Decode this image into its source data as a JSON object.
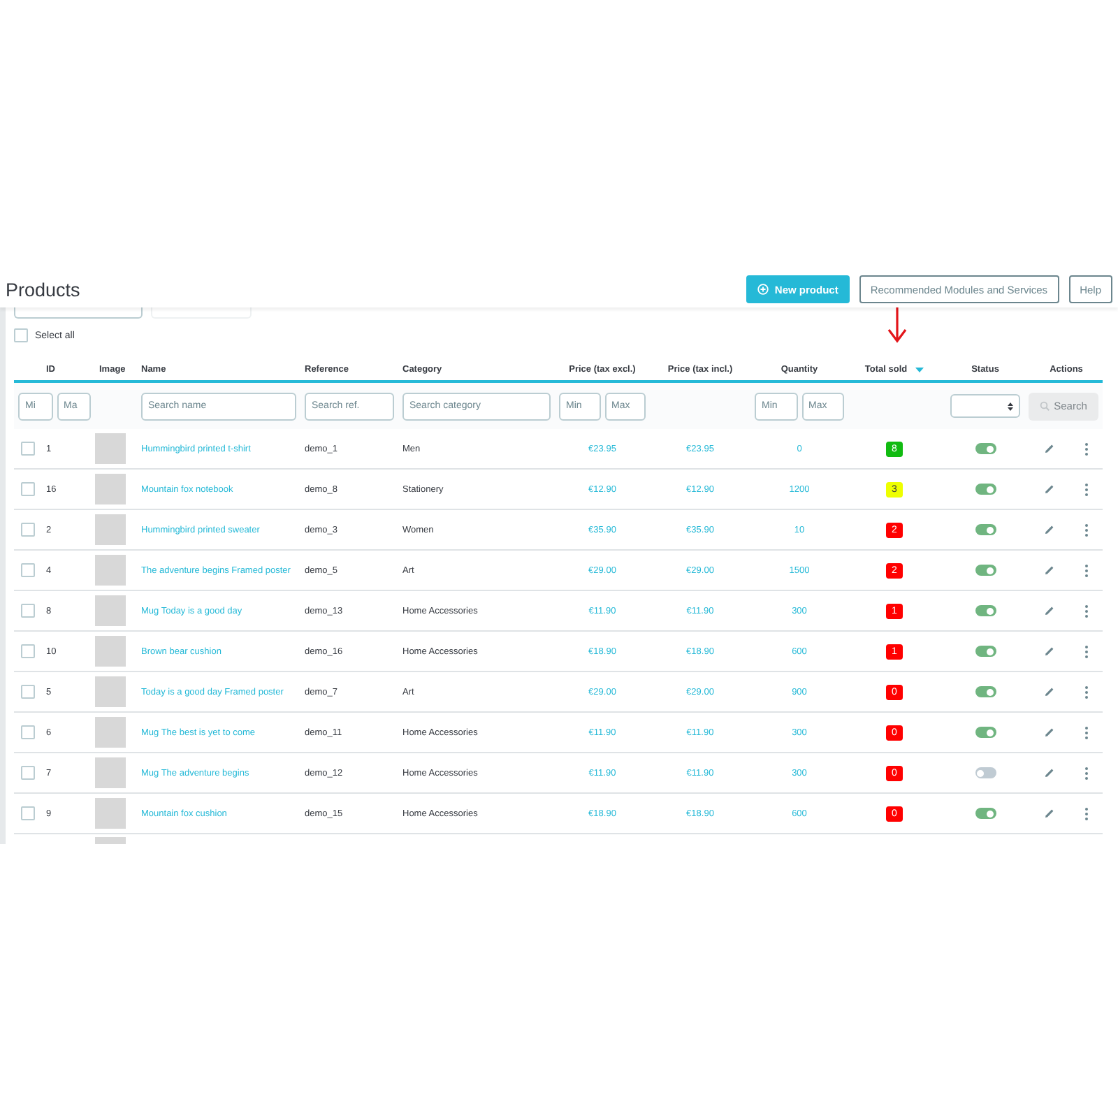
{
  "page": {
    "title": "Products"
  },
  "toolbar_buttons": [
    {
      "kind": "primary",
      "label": "New product"
    },
    {
      "kind": "outline",
      "label": "Recommended Modules and Services"
    },
    {
      "kind": "outline",
      "label": "Help"
    }
  ],
  "select_all": {
    "label": "Select all",
    "checked": false
  },
  "columns": [
    {
      "label": "ID"
    },
    {
      "label": "Image"
    },
    {
      "label": "Name"
    },
    {
      "label": "Reference"
    },
    {
      "label": "Category"
    },
    {
      "label": "Price (tax excl.)"
    },
    {
      "label": "Price (tax incl.)"
    },
    {
      "label": "Quantity"
    },
    {
      "label": "Total sold",
      "sorted": true
    },
    {
      "label": "Status"
    },
    {
      "label": "Actions"
    }
  ],
  "filters": {
    "id_min": {
      "placeholder": "Mi"
    },
    "id_max": {
      "placeholder": "Ma"
    },
    "name": {
      "placeholder": "Search name"
    },
    "reference": {
      "placeholder": "Search ref."
    },
    "category": {
      "placeholder": "Search category"
    },
    "price_min": {
      "placeholder": "Min"
    },
    "price_max": {
      "placeholder": "Max"
    },
    "qty_min": {
      "placeholder": "Min"
    },
    "qty_max": {
      "placeholder": "Max"
    },
    "search_button": "Search"
  },
  "rows": [
    {
      "checked": false,
      "id": "1",
      "name": "Hummingbird printed t-shirt",
      "reference": "demo_1",
      "category": "Men",
      "price_excl": "€23.95",
      "price_incl": "€23.95",
      "quantity": "0",
      "total_sold": "8",
      "color": "#11bb11",
      "on": true
    },
    {
      "checked": false,
      "id": "16",
      "name": "Mountain fox notebook",
      "reference": "demo_8",
      "category": "Stationery",
      "price_excl": "€12.90",
      "price_incl": "€12.90",
      "quantity": "1200",
      "total_sold": "3",
      "color": "#eeff00",
      "on": true
    },
    {
      "checked": false,
      "id": "2",
      "name": "Hummingbird printed sweater",
      "reference": "demo_3",
      "category": "Women",
      "price_excl": "€35.90",
      "price_incl": "€35.90",
      "quantity": "10",
      "total_sold": "2",
      "color": "#ff0000",
      "on": true
    },
    {
      "checked": false,
      "id": "4",
      "name": "The adventure begins Framed poster",
      "reference": "demo_5",
      "category": "Art",
      "price_excl": "€29.00",
      "price_incl": "€29.00",
      "quantity": "1500",
      "total_sold": "2",
      "color": "#ff0000",
      "on": true
    },
    {
      "checked": false,
      "id": "8",
      "name": "Mug Today is a good day",
      "reference": "demo_13",
      "category": "Home Accessories",
      "price_excl": "€11.90",
      "price_incl": "€11.90",
      "quantity": "300",
      "total_sold": "1",
      "color": "#ff0000",
      "on": true
    },
    {
      "checked": false,
      "id": "10",
      "name": "Brown bear cushion",
      "reference": "demo_16",
      "category": "Home Accessories",
      "price_excl": "€18.90",
      "price_incl": "€18.90",
      "quantity": "600",
      "total_sold": "1",
      "color": "#ff0000",
      "on": true
    },
    {
      "checked": false,
      "id": "5",
      "name": "Today is a good day Framed poster",
      "reference": "demo_7",
      "category": "Art",
      "price_excl": "€29.00",
      "price_incl": "€29.00",
      "quantity": "900",
      "total_sold": "0",
      "color": "#ff0000",
      "on": true
    },
    {
      "checked": false,
      "id": "6",
      "name": "Mug The best is yet to come",
      "reference": "demo_11",
      "category": "Home Accessories",
      "price_excl": "€11.90",
      "price_incl": "€11.90",
      "quantity": "300",
      "total_sold": "0",
      "color": "#ff0000",
      "on": true
    },
    {
      "checked": false,
      "id": "7",
      "name": "Mug The adventure begins",
      "reference": "demo_12",
      "category": "Home Accessories",
      "price_excl": "€11.90",
      "price_incl": "€11.90",
      "quantity": "300",
      "total_sold": "0",
      "color": "#ff0000",
      "on": false
    },
    {
      "checked": false,
      "id": "9",
      "name": "Mountain fox cushion",
      "reference": "demo_15",
      "category": "Home Accessories",
      "price_excl": "€18.90",
      "price_incl": "€18.90",
      "quantity": "600",
      "total_sold": "0",
      "color": "#ff0000",
      "on": true
    }
  ]
}
